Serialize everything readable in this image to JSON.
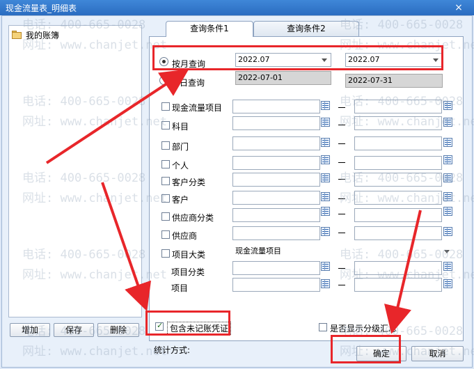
{
  "window": {
    "title": "现金流量表_明细表",
    "close_glyph": "×"
  },
  "tree": {
    "root_label": "我的账簿"
  },
  "left_buttons": {
    "add": "增加",
    "save": "保存",
    "delete": "删除"
  },
  "tabs": [
    {
      "label": "查询条件1"
    },
    {
      "label": "查询条件2"
    }
  ],
  "query": {
    "by_month_label": "按月查询",
    "by_month_checked": true,
    "month_from": "2022.07",
    "month_to": "2022.07",
    "by_day_label": "按日查询",
    "by_day_label_visible": "日查询",
    "date_from": "2022-07-01",
    "date_to": "2022-07-31"
  },
  "filters": [
    {
      "label": "现金流量项目"
    },
    {
      "label": "科目"
    },
    {
      "label": "部门"
    },
    {
      "label": "个人"
    },
    {
      "label": "客户分类"
    },
    {
      "label": "客户"
    },
    {
      "label": "供应商分类"
    },
    {
      "label": "供应商"
    }
  ],
  "project": {
    "category_label": "项目大类",
    "category_value": "现金流量项目",
    "class_label": "项目分类",
    "item_label": "项目"
  },
  "options": {
    "include_unposted_label": "包含未记账凭证",
    "include_unposted_checked": true,
    "show_grade_summary_label": "是否显示分级汇总",
    "show_grade_summary_checked": false,
    "stat_method_label": "统计方式:"
  },
  "footer": {
    "ok": "确定",
    "cancel": "取消"
  },
  "watermark": {
    "phone": "电话: 400-665-0028",
    "site": "网址: www.chanjet.net"
  },
  "colors": {
    "annotation": "#e8262a",
    "titlebar": "#2a6cc0"
  }
}
